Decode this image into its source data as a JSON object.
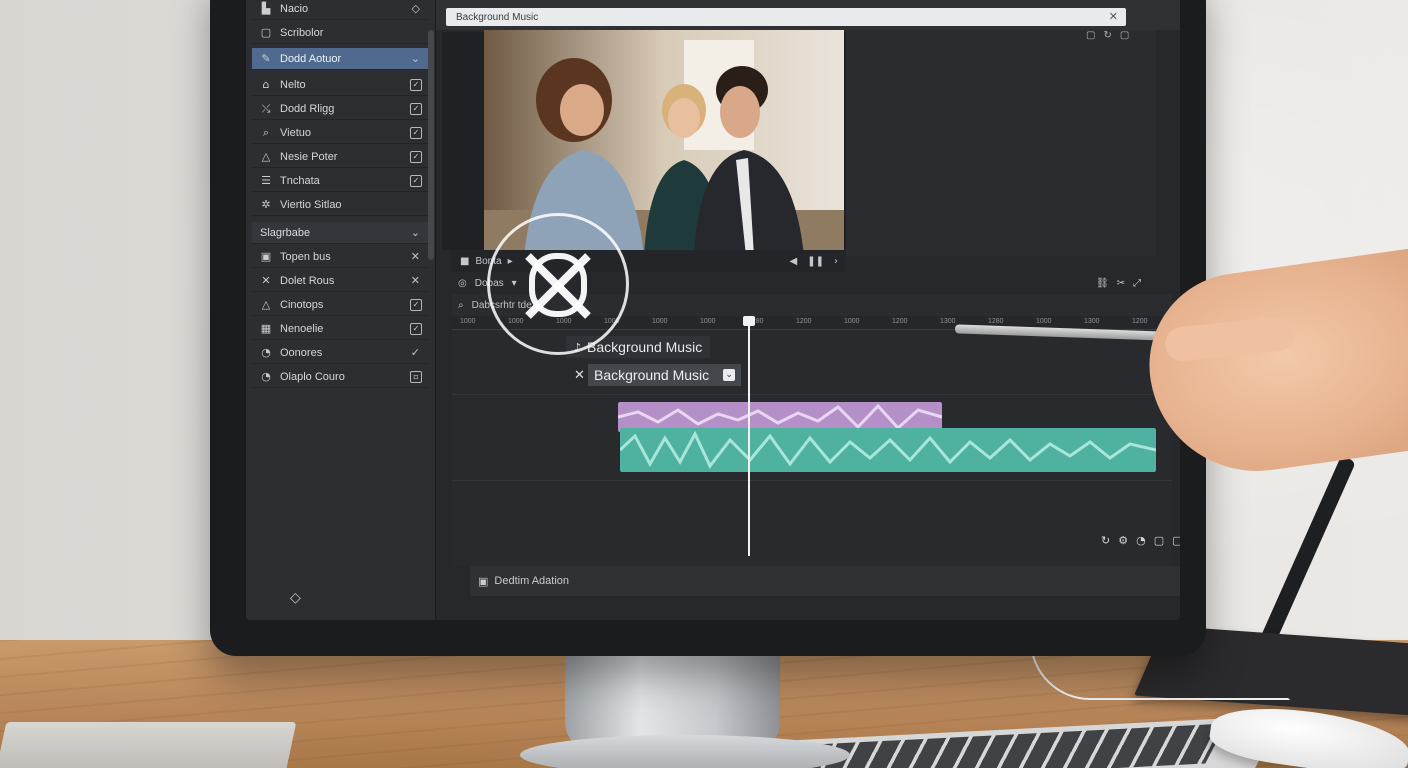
{
  "app": {
    "window_title": "Background Music",
    "panel_title": "Nacio"
  },
  "left_panel": {
    "header": "Scribolor",
    "active_item": "Dodd Aotuor",
    "items": [
      {
        "label": "Nelto",
        "icon": "person-icon"
      },
      {
        "label": "Dodd Rligg",
        "icon": "shuffle-icon"
      },
      {
        "label": "Vietuo",
        "icon": "search-icon"
      },
      {
        "label": "Nesie Poter",
        "icon": "triangle-icon"
      },
      {
        "label": "Tnchata",
        "icon": "list-icon"
      },
      {
        "label": "Viertio Sitlao",
        "icon": "sparkle-icon"
      }
    ],
    "section_header": "Slagrbabe",
    "section_items": [
      {
        "label": "Topen bus",
        "icon": "image-icon"
      },
      {
        "label": "Dolet Rous",
        "icon": "cross-icon"
      },
      {
        "label": "Cinotops",
        "icon": "triangle-icon"
      },
      {
        "label": "Nenoelie",
        "icon": "grid-icon"
      },
      {
        "label": "Oonores",
        "icon": "clock-icon"
      },
      {
        "label": "Olaplo Couro",
        "icon": "clock-icon"
      }
    ]
  },
  "transport": {
    "label": "Bonta"
  },
  "timeline": {
    "toolbar_label": "Dobas",
    "search_label": "Dabcsrhtr tde",
    "ruler_ticks": [
      "1000",
      "1000",
      "1000",
      "1000",
      "1000",
      "1000",
      "1280",
      "1200",
      "1000",
      "1200",
      "1300",
      "1280",
      "1000",
      "1300",
      "1200"
    ],
    "clip_badge": "Background Music",
    "clip_dropdown": "Background Music"
  },
  "footer": {
    "label": "Dedtim Adation"
  },
  "colors": {
    "accent": "#4f6a8e",
    "purple_clip": "#b48fc8",
    "green_clip": "#4fb2a0"
  }
}
